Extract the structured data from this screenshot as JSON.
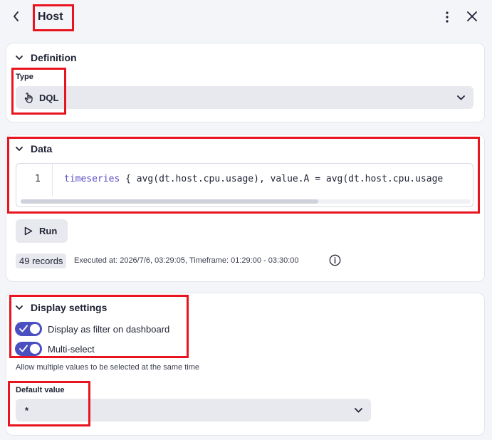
{
  "header": {
    "title": "Host"
  },
  "definition": {
    "section_title": "Definition",
    "type_label": "Type",
    "type_value": "DQL"
  },
  "data_section": {
    "section_title": "Data",
    "line_number": "1",
    "code_keyword": "timeseries",
    "code_rest": " { avg(dt.host.cpu.usage), value.A = avg(dt.host.cpu.usage",
    "run_label": "Run",
    "records_badge": "49 records",
    "executed_text": "Executed at: 2026/7/6, 03:29:05, Timeframe: 01:29:00 - 03:30:00"
  },
  "display_settings": {
    "section_title": "Display settings",
    "toggles": [
      {
        "label": "Display as filter on dashboard",
        "on": true
      },
      {
        "label": "Multi-select",
        "on": true
      }
    ],
    "helper_text": "Allow multiple values to be selected at the same time",
    "default_label": "Default value",
    "default_value": "*"
  },
  "colors": {
    "accent": "#4a4fc0",
    "highlight": "#e8141f",
    "background": "#f4f5f8"
  },
  "icons": {
    "back": "chevron-left-icon",
    "more": "more-vertical-icon",
    "close": "close-icon",
    "type": "dql-icon",
    "run": "play-icon",
    "info": "info-icon"
  }
}
